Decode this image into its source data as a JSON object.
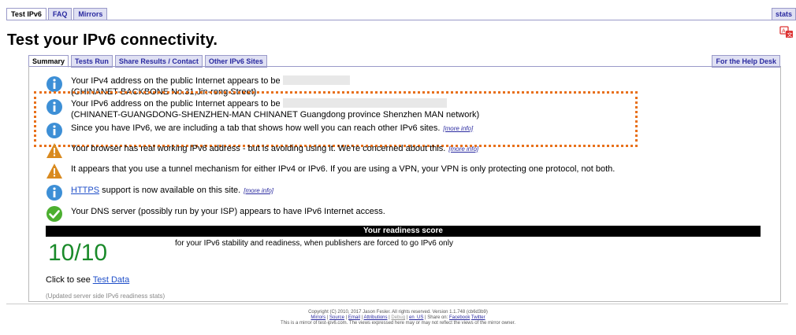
{
  "nav": {
    "tabs": [
      "Test IPv6",
      "FAQ",
      "Mirrors"
    ],
    "stats": "stats"
  },
  "page": {
    "title": "Test your IPv6 connectivity."
  },
  "subnav": {
    "tabs": [
      "Summary",
      "Tests Run",
      "Share Results / Contact",
      "Other IPv6 Sites"
    ],
    "help": "For the Help Desk"
  },
  "results": {
    "ipv4_line1": "Your IPv4 address on the public Internet appears to be",
    "ipv4_line2": "(CHINANET-BACKBONE No.31,Jin-rong Street)",
    "ipv6_line1": "Your IPv6 address on the public Internet appears to be",
    "ipv6_line2": "(CHINANET-GUANGDONG-SHENZHEN-MAN CHINANET Guangdong province Shenzhen MAN network)",
    "ipv6_tab": "Since you have IPv6, we are including a tab that shows how well you can reach other IPv6 sites.",
    "browser": "Your browser has real working IPv6 address - but is avoiding using it. We're concerned about this.",
    "tunnel": "It appears that you use a tunnel mechanism for either IPv4 or IPv6. If you are using a VPN, your VPN is only protecting one protocol, not both.",
    "https_link": "HTTPS",
    "https_rest": "support is now available on this site.",
    "dns": "Your DNS server (possibly run by your ISP) appears to have IPv6 Internet access.",
    "more_info": "[more info]"
  },
  "score": {
    "heading": "Your readiness score",
    "value": "10/10",
    "desc": "for your IPv6 stability and readiness, when publishers are forced to go IPv6 only"
  },
  "links": {
    "click_to_see": "Click to see",
    "test_data": "Test Data",
    "updated": "(Updated server side IPv6 readiness stats)"
  },
  "footer": {
    "line1": "Copyright (C) 2010, 2017 Jason Fesler. All rights reserved. Version 1.1.748 (cb6d3b9)",
    "mirrors": "Mirrors",
    "source": "Source",
    "email": "Email",
    "attributions": "Attributions",
    "debug": "Debug",
    "locale": "en_US",
    "share_on": "Share on:",
    "facebook": "Facebook",
    "twitter": "Twitter",
    "line3": "This is a mirror of test-ipv6.com. The views expressed here may or may not reflect the views of the mirror owner."
  },
  "colors": {
    "accent_tab": "#dfe0f3",
    "link": "#1f4fc9",
    "score_green": "#1a8a2a",
    "highlight": "#e8701a",
    "info_blue": "#3d8fd6",
    "warning_orange": "#d98a1f",
    "ok_green": "#4caf30"
  }
}
